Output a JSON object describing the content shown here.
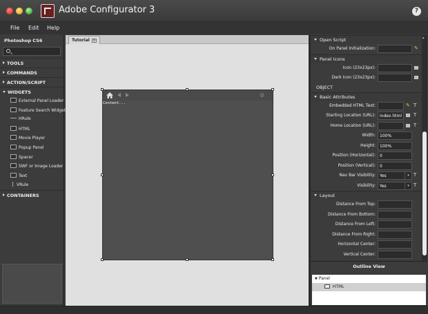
{
  "window": {
    "title": "Adobe Configurator 3",
    "help_label": "?"
  },
  "menu": [
    "File",
    "Edit",
    "Help"
  ],
  "left_panel": {
    "header": "Photoshop CS6",
    "search_placeholder": "",
    "categories": [
      {
        "label": "TOOLS",
        "expanded": false
      },
      {
        "label": "COMMANDS",
        "expanded": false
      },
      {
        "label": "ACTION/SCRIPT",
        "expanded": false
      },
      {
        "label": "WIDGETS",
        "expanded": true
      }
    ],
    "widgets": [
      {
        "label": "External Panel Loader",
        "icon": "external-panel-loader-icon"
      },
      {
        "label": "Feature Search Widget",
        "icon": "feature-search-icon"
      },
      {
        "label": "HRule",
        "icon": "hrule-icon"
      },
      {
        "label": "HTML",
        "icon": "html-icon"
      },
      {
        "label": "Movie Player",
        "icon": "movie-player-icon"
      },
      {
        "label": "Popup Panel",
        "icon": "popup-panel-icon"
      },
      {
        "label": "Spacer",
        "icon": "spacer-icon"
      },
      {
        "label": "SWF or Image Loader",
        "icon": "swf-loader-icon"
      },
      {
        "label": "Text",
        "icon": "text-icon"
      },
      {
        "label": "VRule",
        "icon": "vrule-icon"
      }
    ],
    "containers_label": "CONTAINERS"
  },
  "document": {
    "tab_label": "Tutorial",
    "tab_close": "×",
    "content_text": "Content...",
    "gear_glyph": "⚙"
  },
  "properties": {
    "open_script": {
      "title": "Open Script",
      "on_panel_init_label": "On Panel Initialization:",
      "on_panel_init_value": ""
    },
    "panel_icons": {
      "title": "Panel Icons",
      "icon_label": "Icon (23x23px):",
      "dark_icon_label": "Dark Icon (23x23px):"
    },
    "object_label": "OBJECT",
    "basic_attributes": {
      "title": "Basic Attributes",
      "embedded_html_label": "Embedded HTML Text:",
      "embedded_html_value": "",
      "starting_location_label": "Starting Location (URL):",
      "starting_location_value": "index.html",
      "home_location_label": "Home Location (URL):",
      "home_location_value": "",
      "width_label": "Width:",
      "width_value": "100%",
      "height_label": "Height:",
      "height_value": "100%",
      "pos_h_label": "Position (Horizontal):",
      "pos_h_value": "0",
      "pos_v_label": "Position (Vertical):",
      "pos_v_value": "0",
      "nav_bar_label": "Nav Bar Visibility:",
      "nav_bar_value": "Yes",
      "visibility_label": "Visibility:",
      "visibility_value": "Yes"
    },
    "layout": {
      "title": "Layout",
      "dist_top_label": "Distance From Top:",
      "dist_bottom_label": "Distance From Bottom:",
      "dist_left_label": "Distance From Left:",
      "dist_right_label": "Distance From Right:",
      "h_center_label": "Horizontal Center:",
      "v_center_label": "Vertical Center:"
    },
    "t_glyph": "T",
    "pencil_glyph": "✎"
  },
  "outline": {
    "title": "Outline View",
    "root": "Panel",
    "child": "HTML"
  }
}
